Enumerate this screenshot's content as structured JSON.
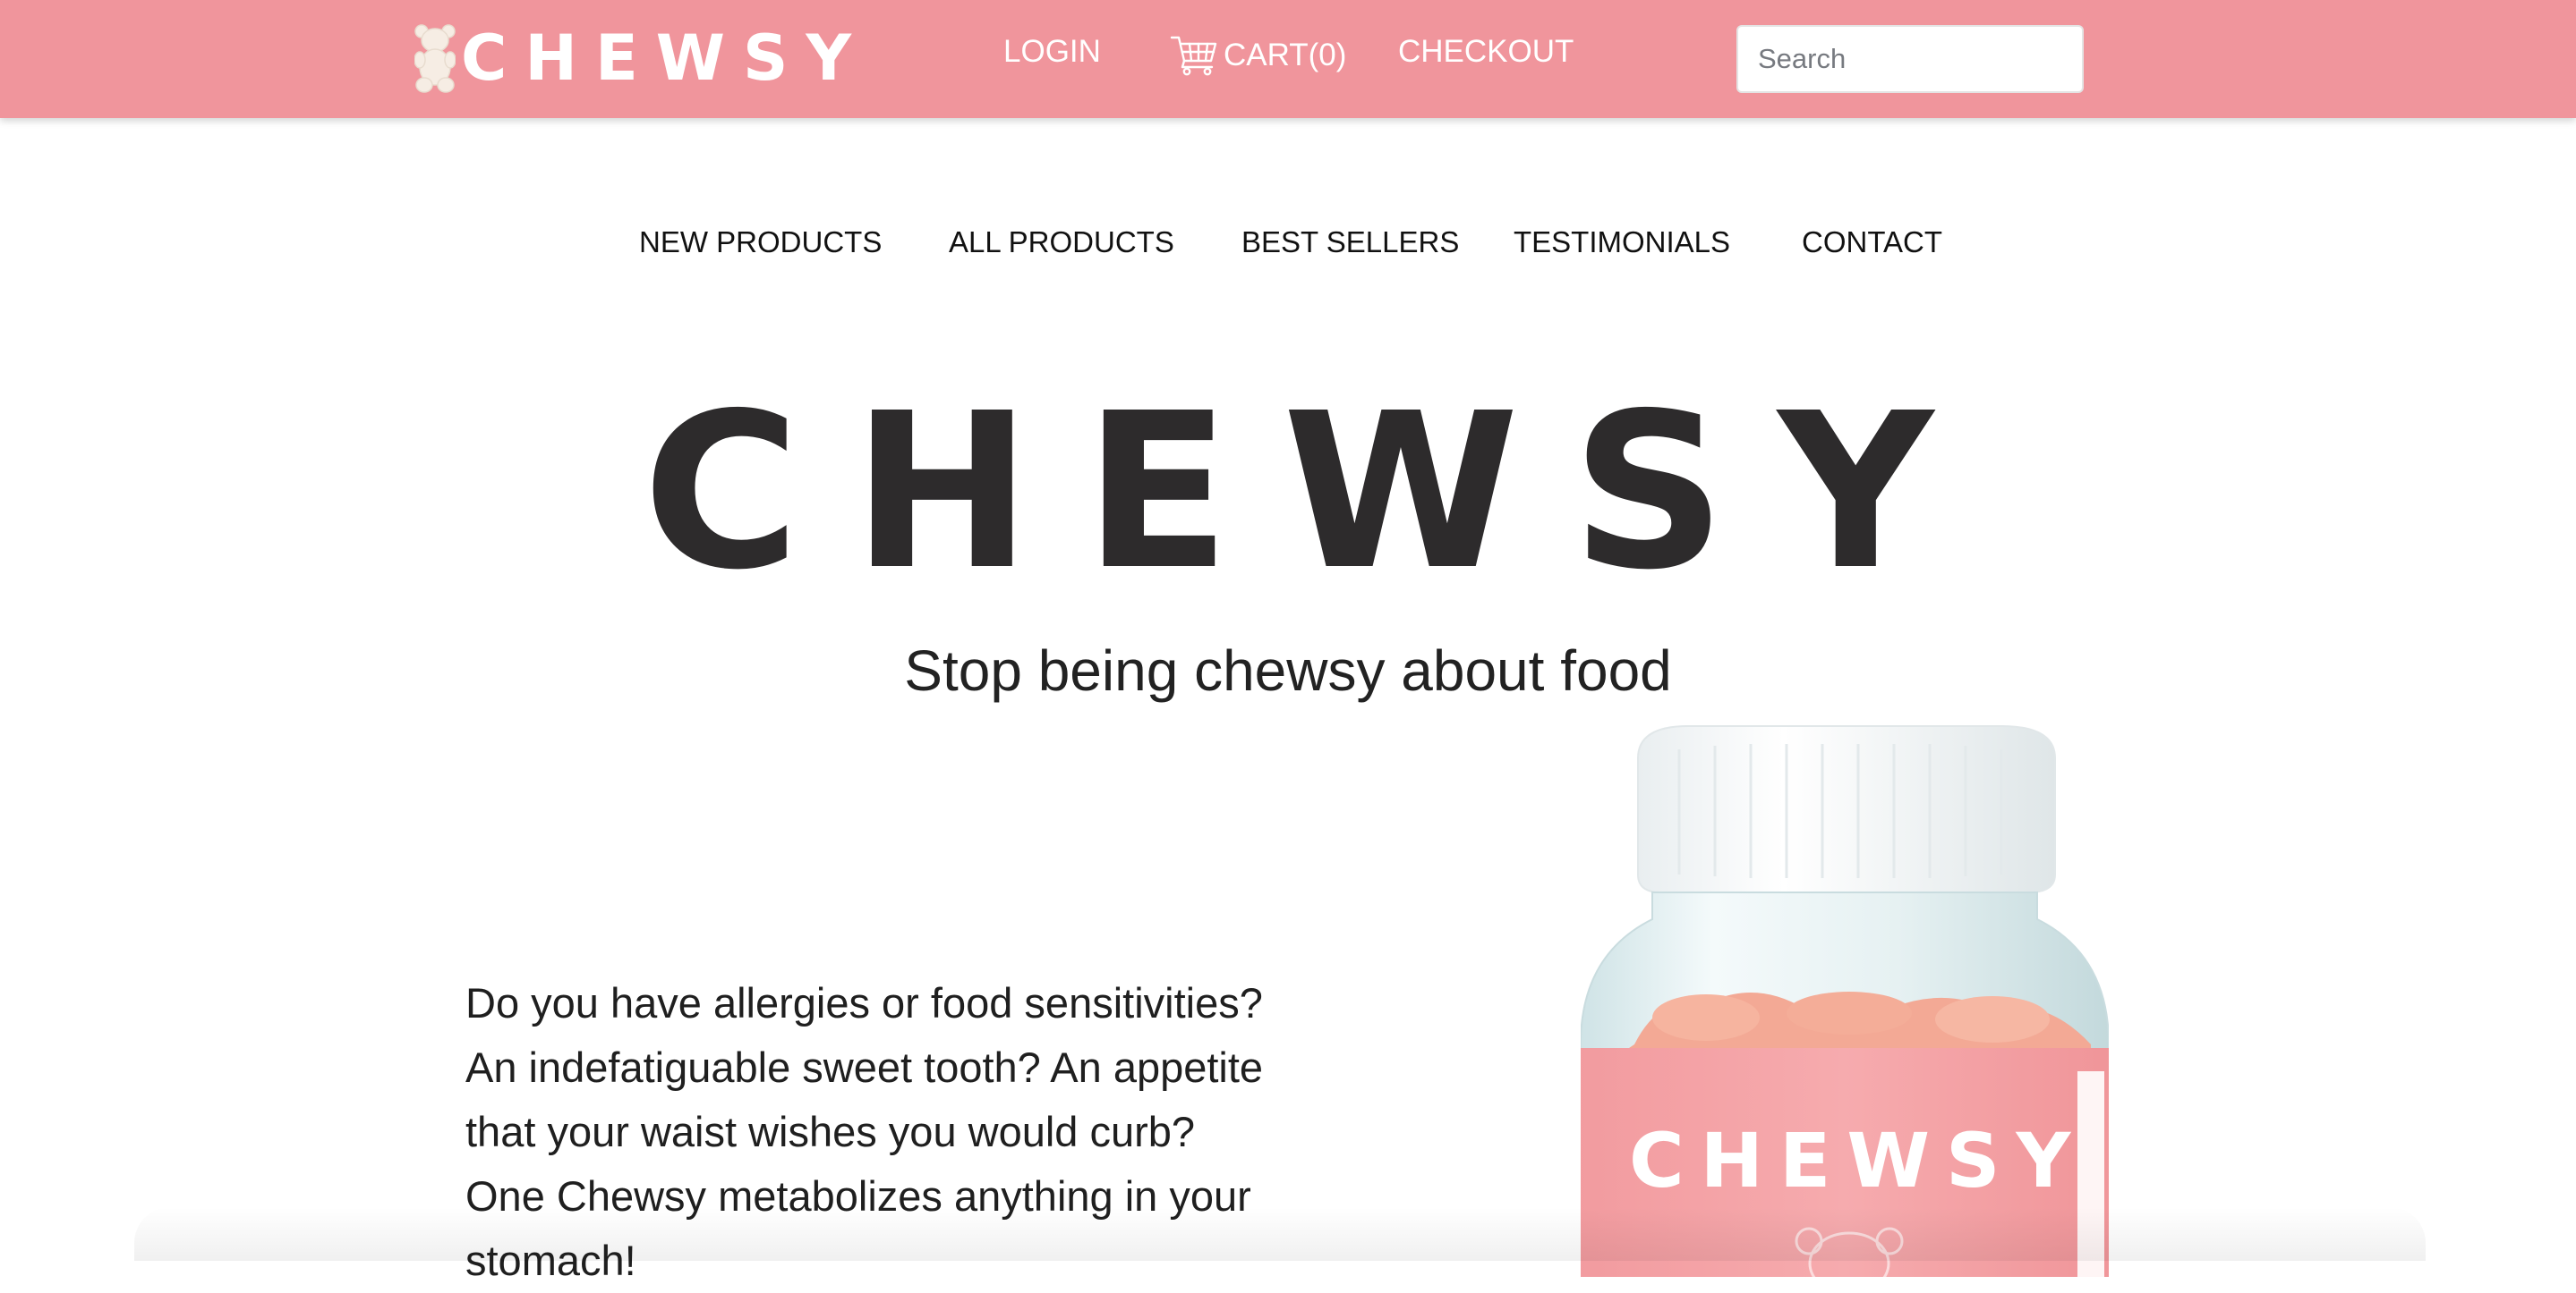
{
  "header": {
    "brand": "CHEWSY",
    "nav": {
      "login": "LOGIN",
      "cart": "CART(0)",
      "checkout": "CHECKOUT"
    },
    "search": {
      "placeholder": "Search",
      "value": ""
    },
    "icons": {
      "logo": "gummy-bear-icon",
      "cart": "shopping-cart-icon"
    },
    "colors": {
      "bar": "#f0959c",
      "text": "#ffffff"
    }
  },
  "main_nav": {
    "items": [
      {
        "label": "NEW PRODUCTS"
      },
      {
        "label": "ALL PRODUCTS"
      },
      {
        "label": "BEST SELLERS"
      },
      {
        "label": "TESTIMONIALS"
      },
      {
        "label": "CONTACT"
      }
    ]
  },
  "hero": {
    "title": "CHEWSY",
    "subtitle": "Stop being chewsy about food"
  },
  "intro": {
    "text": "Do you have allergies or food sensitivities? An indefatiguable sweet tooth? An appetite that your waist wishes you would curb? One Chewsy metabolizes anything in your stomach!"
  },
  "product": {
    "label": "CHEWSY",
    "image": "gummy-vitamin-jar",
    "label_color": "#f5a3a6"
  }
}
